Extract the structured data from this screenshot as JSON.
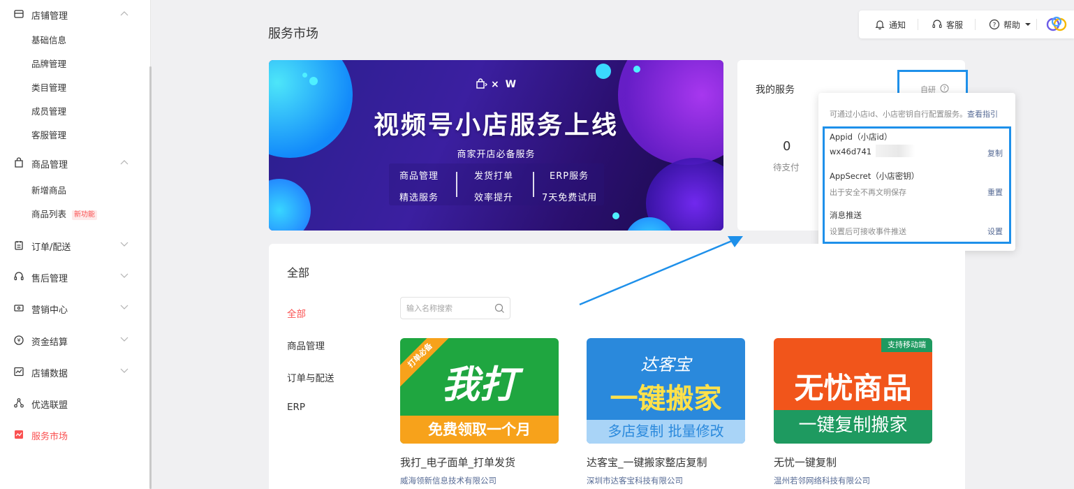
{
  "sidebar": {
    "groups": [
      {
        "label": "店铺管理",
        "icon": "shop-icon",
        "expanded": true
      },
      {
        "label": "商品管理",
        "icon": "bag-icon",
        "expanded": true
      },
      {
        "label": "订单/配送",
        "icon": "order-icon",
        "expanded": false
      },
      {
        "label": "售后管理",
        "icon": "headset-icon",
        "expanded": false
      },
      {
        "label": "营销中心",
        "icon": "ticket-icon",
        "expanded": false
      },
      {
        "label": "资金结算",
        "icon": "yuan-icon",
        "expanded": false
      },
      {
        "label": "店铺数据",
        "icon": "chart-icon",
        "expanded": false
      },
      {
        "label": "优选联盟",
        "icon": "network-icon",
        "expanded": false
      },
      {
        "label": "服务市场",
        "icon": "market-icon",
        "expanded": false,
        "active": true
      }
    ],
    "shop_items": [
      "基础信息",
      "品牌管理",
      "类目管理",
      "成员管理",
      "客服管理"
    ],
    "product_items": [
      "新增商品",
      "商品列表"
    ],
    "new_badge": "新功能"
  },
  "topbar": {
    "notify": "通知",
    "service": "客服",
    "help": "帮助"
  },
  "page_title": "服务市场",
  "banner": {
    "logo_text": "× W",
    "headline": "视频号小店服务上线",
    "subline": "商家开店必备服务",
    "features": [
      "商品管理",
      "精选服务",
      "发货打单",
      "效率提升",
      "ERP服务",
      "7天免费试用"
    ]
  },
  "my_services": {
    "title": "我的服务",
    "trigger_text": "自研",
    "count": "0",
    "count_label": "待支付"
  },
  "popover": {
    "hint": "可通过小店id、小店密钥自行配置服务。",
    "hint_link": "查看指引",
    "appid_label": "Appid（小店id）",
    "appid_value": "wx46d741",
    "appid_action": "复制",
    "secret_label": "AppSecret（小店密钥）",
    "secret_value": "出于安全不再文明保存",
    "secret_action": "重置",
    "push_label": "消息推送",
    "push_value": "设置后可接收事件推送",
    "push_action": "设置"
  },
  "catalog": {
    "title": "全部",
    "categories": [
      "全部",
      "商品管理",
      "订单与配送",
      "ERP"
    ],
    "search_placeholder": "输入名称搜索",
    "products": [
      {
        "name": "我打_电子面单_打单发货",
        "company": "威海领新信息技术有限公司",
        "img_main": "我打",
        "img_sub": "免费领取一个月",
        "ribbon": "打单必备"
      },
      {
        "name": "达客宝_一键搬家整店复制",
        "company": "深圳市达客宝科技有限公司",
        "img_logo": "达客宝",
        "img_main": "一键搬家",
        "img_sub": "多店复制 批量修改"
      },
      {
        "name": "无忧一键复制",
        "company": "温州若邻网络科技有限公司",
        "img_tag": "支持移动端",
        "img_main": "无忧商品",
        "img_sub": "一键复制搬家"
      }
    ]
  },
  "colors": {
    "accent_red": "#fa5151",
    "link_blue": "#576b95",
    "highlight_blue": "#1e90ea"
  }
}
